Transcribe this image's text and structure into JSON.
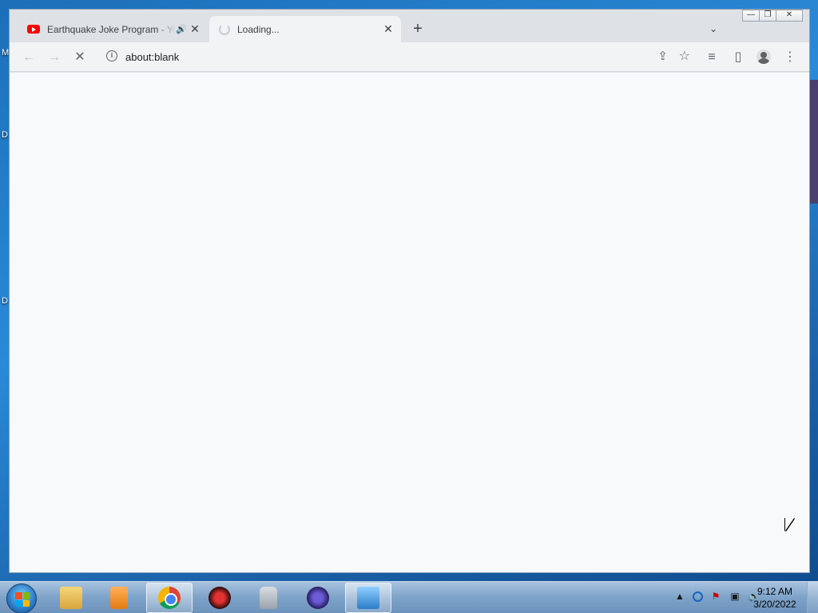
{
  "desktop": {
    "edge_labels": [
      "M",
      "D",
      "D"
    ]
  },
  "browser": {
    "window_controls": {
      "minimize": "—",
      "restore": "❐",
      "close": "✕"
    },
    "tabs": [
      {
        "title": "Earthquake Joke Program - YouTube",
        "favicon": "youtube-icon",
        "audio": "🔊",
        "close": "✕"
      },
      {
        "title": "Loading...",
        "favicon": "loading-spinner-icon",
        "close": "✕"
      }
    ],
    "new_tab": "+",
    "tab_search": "⌄",
    "toolbar": {
      "back": "←",
      "forward": "→",
      "stop": "✕",
      "url": "about:blank",
      "info": "i",
      "share": "⇪",
      "bookmark": "☆",
      "reading_list": "≡",
      "side_panel": "▯",
      "menu": "⋮"
    }
  },
  "taskbar": {
    "apps": [
      "windows-explorer",
      "media-player",
      "google-chrome",
      "red-app",
      "security-lock",
      "blue-app",
      "control-panel"
    ],
    "tray": {
      "arrow": "▲"
    },
    "clock": {
      "time": "9:12 AM",
      "date": "3/20/2022"
    }
  }
}
